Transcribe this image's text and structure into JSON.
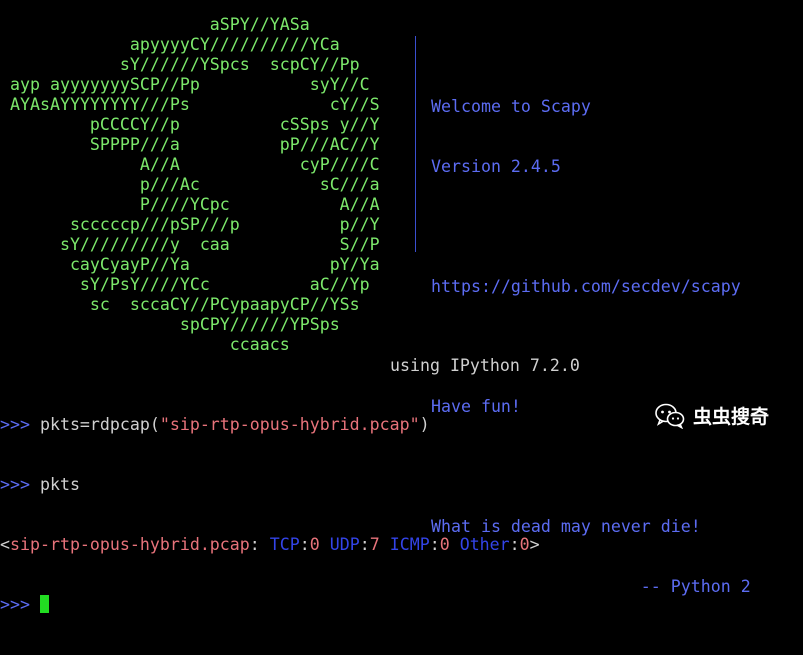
{
  "logo_lines": [
    "                    aSPY//YASa",
    "            apyyyyCY//////////YCa",
    "           sY//////YSpcs  scpCY//Pp",
    "ayp ayyyyyyySCP//Pp           syY//C",
    "AYAsAYYYYYYYY///Ps              cY//S",
    "        pCCCCY//p          cSSps y//Y",
    "        SPPPP///a          pP///AC//Y",
    "             A//A            cyP////C",
    "             p///Ac            sC///a",
    "             P////YCpc           A//A",
    "      scccccp///pSP///p          p//Y",
    "     sY/////////y  caa           S//P",
    "      cayCyayP//Ya              pY/Ya",
    "       sY/PsY////YCc          aC//Yp",
    "        sc  sccaCY//PCypaapyCP//YSs",
    "                 spCPY//////YPSps",
    "                      ccaacs"
  ],
  "welcome": {
    "line1": "Welcome to Scapy",
    "line2": "Version 2.4.5",
    "line3": "",
    "line4": "https://github.com/secdev/scapy",
    "line5": "",
    "line6": "Have fun!",
    "line7": "",
    "line8": "What is dead may never die!",
    "line9": "                     -- Python 2"
  },
  "ipython_banner": "using IPython 7.2.0",
  "session": {
    "prompt": ">>> ",
    "cmd1_prefix": "pkts=rdpcap(",
    "cmd1_string": "\"sip-rtp-opus-hybrid.pcap\"",
    "cmd1_suffix": ")",
    "cmd2": "pkts",
    "out_open": "<",
    "out_name": "sip-rtp-opus-hybrid.pcap",
    "out_sep": ": ",
    "tcp_label": "TCP",
    "tcp_val": "0",
    "udp_label": "UDP",
    "udp_val": "7",
    "icmp_label": "ICMP",
    "icmp_val": "0",
    "other_label": "Other",
    "other_val": "0",
    "out_close": ">",
    "colon": ":",
    "space": " "
  },
  "watermark": {
    "text": "虫虫搜奇",
    "icon": "wechat-icon"
  },
  "colors": {
    "background": "#000000",
    "logo": "#7CE86B",
    "welcome": "#5c6cf2",
    "string": "#e8737b",
    "keyword": "#3344e8",
    "cursor": "#22dd22"
  }
}
